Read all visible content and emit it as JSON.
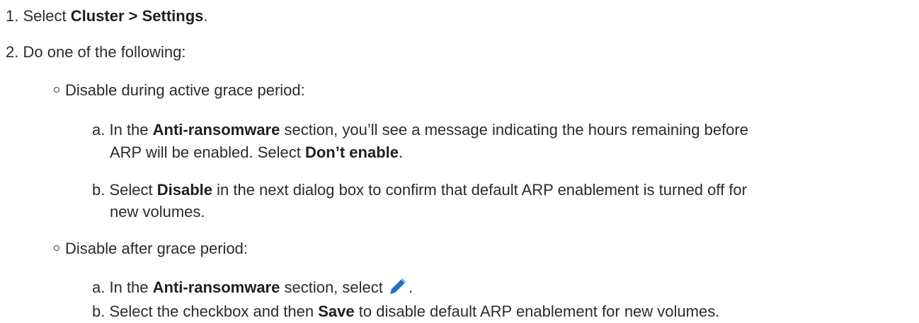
{
  "steps": [
    {
      "number": "1.",
      "text_prefix": "Select ",
      "bold": "Cluster > Settings",
      "text_suffix": "."
    },
    {
      "number": "2.",
      "text": "Do one of the following:"
    }
  ],
  "options": [
    {
      "label": "Disable during active grace period:",
      "substeps": [
        {
          "letter": "a.",
          "line1_prefix": "In the ",
          "line1_bold": "Anti-ransomware",
          "line1_suffix": " section, you’ll see a message indicating the hours remaining before",
          "line2_prefix": "ARP will be enabled. Select ",
          "line2_bold": "Don’t enable",
          "line2_suffix": "."
        },
        {
          "letter": "b.",
          "line1_prefix": "Select ",
          "line1_bold": "Disable",
          "line1_suffix": " in the next dialog box to confirm that default ARP enablement is turned off for",
          "line2": "new volumes."
        }
      ]
    },
    {
      "label": "Disable after grace period:",
      "substeps": [
        {
          "letter": "a.",
          "prefix": "In the ",
          "bold": "Anti-ransomware",
          "suffix": " section, select ",
          "icon": "pencil-edit-icon",
          "end": "."
        },
        {
          "letter": "b.",
          "prefix": "Select the checkbox and then ",
          "bold": "Save",
          "suffix": " to disable default ARP enablement for new volumes."
        }
      ]
    }
  ],
  "colors": {
    "text": "#2b2b2b",
    "icon": "#1a73c8"
  }
}
